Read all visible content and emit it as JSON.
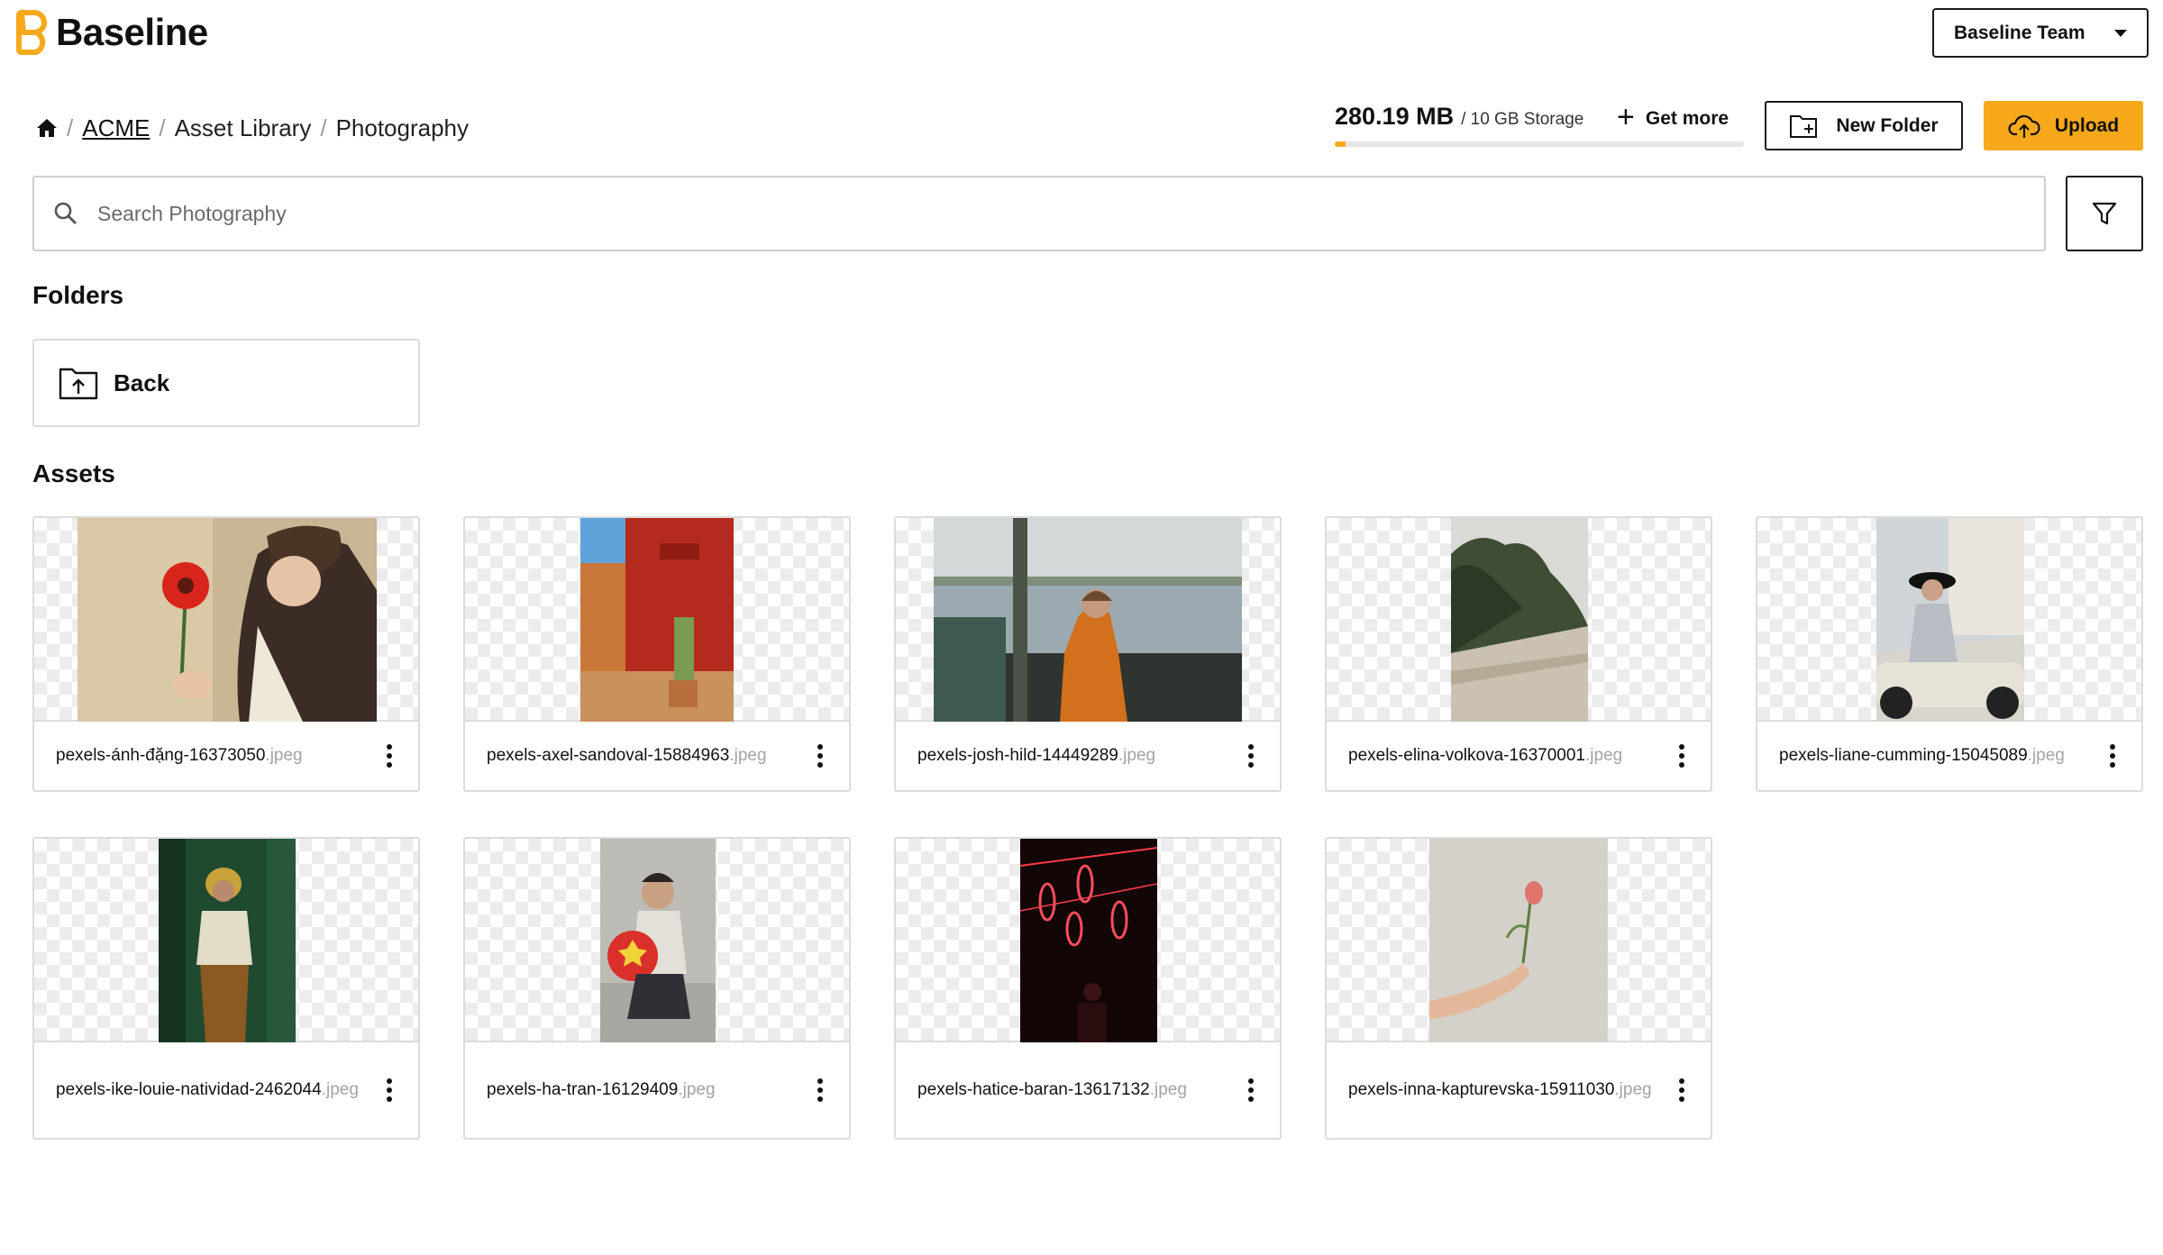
{
  "app": {
    "name": "Baseline",
    "brand_color": "#f7a91b"
  },
  "team_select": {
    "label": "Baseline Team"
  },
  "breadcrumb": {
    "items": [
      "ACME",
      "Asset Library",
      "Photography"
    ]
  },
  "storage": {
    "used": "280.19 MB",
    "total": "/ 10 GB Storage",
    "used_fraction": 0.027,
    "get_more": "Get more"
  },
  "actions": {
    "new_folder": "New Folder",
    "upload": "Upload"
  },
  "search": {
    "placeholder": "Search Photography",
    "value": ""
  },
  "sections": {
    "folders": "Folders",
    "assets": "Assets"
  },
  "folders": [
    {
      "label": "Back"
    }
  ],
  "assets": [
    {
      "name": "pexels-ánh-đặng-16373050",
      "ext": ".jpeg"
    },
    {
      "name": "pexels-axel-sandoval-15884963",
      "ext": ".jpeg"
    },
    {
      "name": "pexels-josh-hild-14449289",
      "ext": ".jpeg"
    },
    {
      "name": "pexels-elina-volkova-16370001",
      "ext": ".jpeg"
    },
    {
      "name": "pexels-liane-cumming-15045089",
      "ext": ".jpeg"
    },
    {
      "name": "pexels-ike-louie-natividad-2462044",
      "ext": ".jpeg"
    },
    {
      "name": "pexels-ha-tran-16129409",
      "ext": ".jpeg"
    },
    {
      "name": "pexels-hatice-baran-13617132",
      "ext": ".jpeg"
    },
    {
      "name": "pexels-inna-kapturevska-15911030",
      "ext": ".jpeg"
    }
  ]
}
